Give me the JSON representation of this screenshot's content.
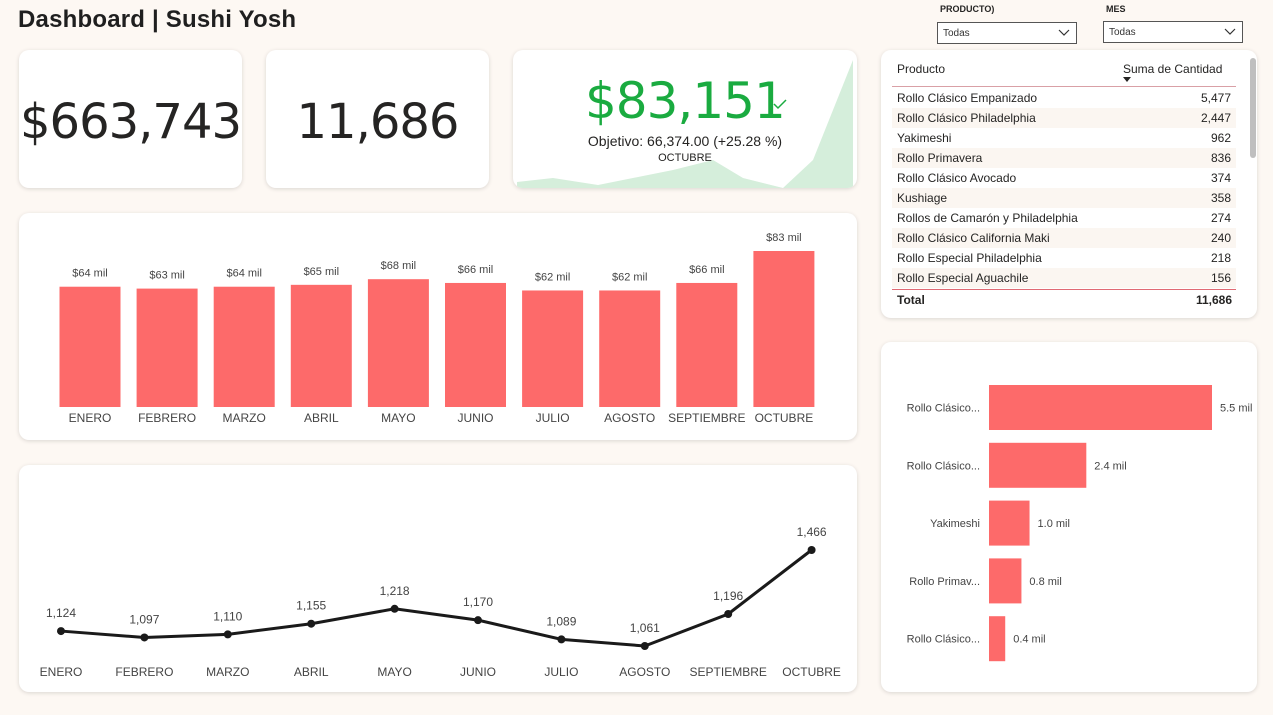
{
  "header": {
    "title": "Dashboard | Sushi Yosh"
  },
  "filters": {
    "producto": {
      "label": "PRODUCTO)",
      "value": "Todas"
    },
    "mes": {
      "label": "MES",
      "value": "Todas"
    }
  },
  "kpis": {
    "ventas": "$663,743",
    "cantidad": "11,686",
    "mes_actual": {
      "value": "$83,151",
      "objetivo": "Objetivo: 66,374.00 (+25.28 %)",
      "mes": "OCTUBRE",
      "status_icon": "check-icon"
    }
  },
  "table": {
    "col_producto": "Producto",
    "col_cantidad": "Suma de Cantidad",
    "rows": [
      {
        "producto": "Rollo Clásico Empanizado",
        "cantidad": "5,477"
      },
      {
        "producto": "Rollo Clásico Philadelphia",
        "cantidad": "2,447"
      },
      {
        "producto": "Yakimeshi",
        "cantidad": "962"
      },
      {
        "producto": "Rollo Primavera",
        "cantidad": "836"
      },
      {
        "producto": "Rollo Clásico Avocado",
        "cantidad": "374"
      },
      {
        "producto": "Kushiage",
        "cantidad": "358"
      },
      {
        "producto": "Rollos de Camarón y Philadelphia",
        "cantidad": "274"
      },
      {
        "producto": "Rollo Clásico California Maki",
        "cantidad": "240"
      },
      {
        "producto": "Rollo Especial Philadelphia",
        "cantidad": "218"
      },
      {
        "producto": "Rollo Especial Aguachile",
        "cantidad": "156"
      }
    ],
    "total_label": "Total",
    "total_value": "11,686"
  },
  "colors": {
    "bar": "#fd6a6a",
    "kpi_green": "#1aab40",
    "area": "#d5eedb",
    "line": "#1a1a1a"
  },
  "chart_data": [
    {
      "type": "bar",
      "categories": [
        "ENERO",
        "FEBRERO",
        "MARZO",
        "ABRIL",
        "MAYO",
        "JUNIO",
        "JULIO",
        "AGOSTO",
        "SEPTIEMBRE",
        "OCTUBRE"
      ],
      "values": [
        64,
        63,
        64,
        65,
        68,
        66,
        62,
        62,
        66,
        83
      ],
      "labels": [
        "$64 mil",
        "$63 mil",
        "$64 mil",
        "$65 mil",
        "$68 mil",
        "$66 mil",
        "$62 mil",
        "$62 mil",
        "$66 mil",
        "$83 mil"
      ],
      "ylim": [
        0,
        83
      ]
    },
    {
      "type": "line",
      "categories": [
        "ENERO",
        "FEBRERO",
        "MARZO",
        "ABRIL",
        "MAYO",
        "JUNIO",
        "JULIO",
        "AGOSTO",
        "SEPTIEMBRE",
        "OCTUBRE"
      ],
      "values": [
        1124,
        1097,
        1110,
        1155,
        1218,
        1170,
        1089,
        1061,
        1196,
        1466
      ],
      "labels": [
        "1,124",
        "1,097",
        "1,110",
        "1,155",
        "1,218",
        "1,170",
        "1,089",
        "1,061",
        "1,196",
        "1,466"
      ]
    },
    {
      "type": "bar",
      "orientation": "horizontal",
      "categories": [
        "Rollo Clásico...",
        "Rollo Clásico...",
        "Yakimeshi",
        "Rollo Primav...",
        "Rollo Clásico..."
      ],
      "values": [
        5.5,
        2.4,
        1.0,
        0.8,
        0.4
      ],
      "labels": [
        "5.5 mil",
        "2.4 mil",
        "1.0 mil",
        "0.8 mil",
        "0.4 mil"
      ]
    }
  ]
}
